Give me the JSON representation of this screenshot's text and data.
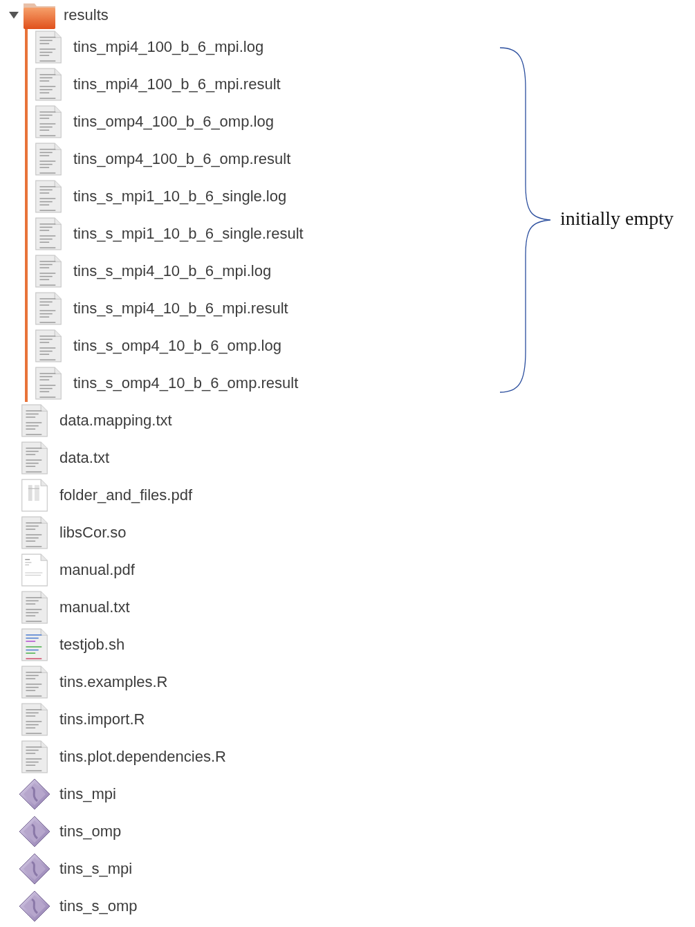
{
  "folder": {
    "name": "results",
    "expanded": true,
    "children": [
      {
        "name": "tins_mpi4_100_b_6_mpi.log",
        "kind": "text"
      },
      {
        "name": "tins_mpi4_100_b_6_mpi.result",
        "kind": "text"
      },
      {
        "name": "tins_omp4_100_b_6_omp.log",
        "kind": "text"
      },
      {
        "name": "tins_omp4_100_b_6_omp.result",
        "kind": "text"
      },
      {
        "name": "tins_s_mpi1_10_b_6_single.log",
        "kind": "text"
      },
      {
        "name": "tins_s_mpi1_10_b_6_single.result",
        "kind": "text"
      },
      {
        "name": "tins_s_mpi4_10_b_6_mpi.log",
        "kind": "text"
      },
      {
        "name": "tins_s_mpi4_10_b_6_mpi.result",
        "kind": "text"
      },
      {
        "name": "tins_s_omp4_10_b_6_omp.log",
        "kind": "text"
      },
      {
        "name": "tins_s_omp4_10_b_6_omp.result",
        "kind": "text"
      }
    ]
  },
  "files": [
    {
      "name": "data.mapping.txt",
      "kind": "text"
    },
    {
      "name": "data.txt",
      "kind": "text"
    },
    {
      "name": "folder_and_files.pdf",
      "kind": "pdf-table"
    },
    {
      "name": "libsCor.so",
      "kind": "text"
    },
    {
      "name": "manual.pdf",
      "kind": "pdf-doc"
    },
    {
      "name": "manual.txt",
      "kind": "text"
    },
    {
      "name": "testjob.sh",
      "kind": "script"
    },
    {
      "name": "tins.examples.R",
      "kind": "text"
    },
    {
      "name": "tins.import.R",
      "kind": "text"
    },
    {
      "name": "tins.plot.dependencies.R",
      "kind": "text"
    },
    {
      "name": "tins_mpi",
      "kind": "executable"
    },
    {
      "name": "tins_omp",
      "kind": "executable"
    },
    {
      "name": "tins_s_mpi",
      "kind": "executable"
    },
    {
      "name": "tins_s_omp",
      "kind": "executable"
    }
  ],
  "annotation": {
    "text": "initially empty"
  }
}
